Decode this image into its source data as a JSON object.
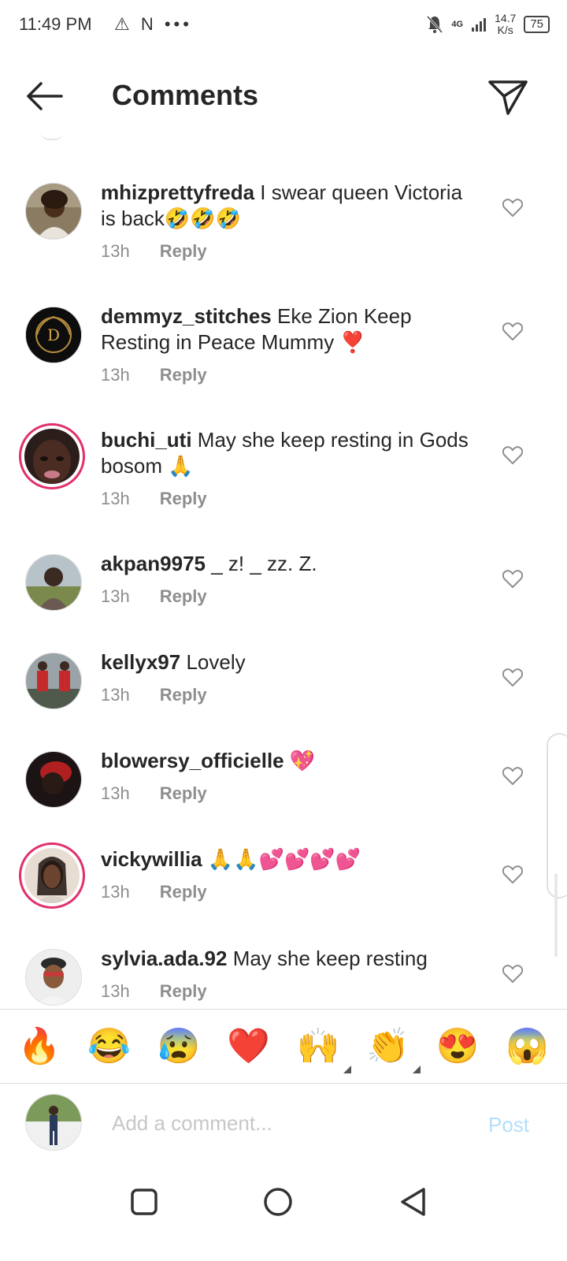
{
  "status_bar": {
    "time": "11:49 PM",
    "left_icons": "⚠ N •••",
    "network": "4G",
    "speed_value": "14.7",
    "speed_unit": "K/s",
    "battery": "75"
  },
  "header": {
    "title": "Comments",
    "back_icon": "back-arrow-icon",
    "send_icon": "paper-plane-icon"
  },
  "comments": [
    {
      "username": "mhizprettyfreda",
      "text": " I swear queen Victoria is  back🤣🤣🤣",
      "time": "13h",
      "reply": "Reply"
    },
    {
      "username": "demmyz_stitches",
      "text": " Eke Zion Keep Resting in Peace Mummy ❣️",
      "time": "13h",
      "reply": "Reply"
    },
    {
      "username": "buchi_uti",
      "text": " May she keep resting in Gods bosom 🙏",
      "time": "13h",
      "reply": "Reply"
    },
    {
      "username": "akpan9975",
      "text": " _ z! _ zz. Z.",
      "time": "13h",
      "reply": "Reply"
    },
    {
      "username": "kellyx97",
      "text": " Lovely",
      "time": "13h",
      "reply": "Reply"
    },
    {
      "username": "blowersy_officielle",
      "text": " 💖",
      "time": "13h",
      "reply": "Reply"
    },
    {
      "username": "vickywillia",
      "text": " 🙏🙏💕💕💕💕",
      "time": "13h",
      "reply": "Reply"
    },
    {
      "username": "sylvia.ada.92",
      "text": " May she keep resting",
      "time": "13h",
      "reply": "Reply"
    }
  ],
  "reactions": [
    "🔥",
    "😂",
    "😰",
    "❤️",
    "🙌",
    "👏",
    "😍",
    "😱"
  ],
  "composer": {
    "placeholder": "Add a comment...",
    "post_label": "Post"
  },
  "colors": {
    "story_ring": "#e1306c",
    "post_disabled": "#b2dffc",
    "meta_gray": "#8e8e8e"
  }
}
